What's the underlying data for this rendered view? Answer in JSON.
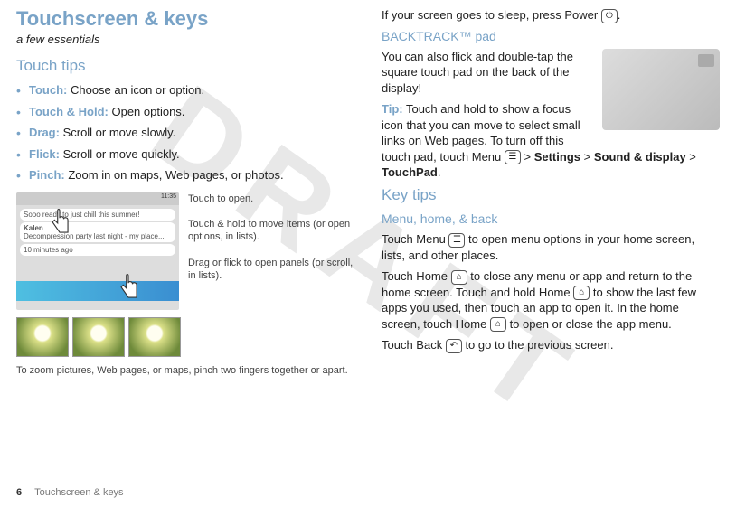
{
  "watermark": "DRAFT",
  "left": {
    "title": "Touchscreen & keys",
    "subtitle": "a few essentials",
    "section_touch_tips": "Touch tips",
    "tips": [
      {
        "term": "Touch:",
        "desc": " Choose an icon or option."
      },
      {
        "term": "Touch & Hold:",
        "desc": " Open options."
      },
      {
        "term": "Drag:",
        "desc": " Scroll or move slowly."
      },
      {
        "term": "Flick:",
        "desc": " Scroll or move quickly."
      },
      {
        "term": "Pinch:",
        "desc": " Zoom in on maps, Web pages, or photos."
      }
    ],
    "figure": {
      "status_time": "11:35",
      "line1": "Sooo ready to just chill this summer!",
      "line2_name": "Kalen",
      "line2_body": "Decompression party last night - my place...",
      "line3": "10 minutes ago",
      "annot1": "Touch to open.",
      "annot2": "Touch & hold to move items (or open options, in lists).",
      "annot3": "Drag or flick to open panels (or scroll, in lists)."
    },
    "zoom_caption": "To zoom pictures, Web pages, or maps, pinch two fingers together or apart."
  },
  "right": {
    "sleep_line_a": "If your screen goes to sleep, press Power ",
    "sleep_line_b": ".",
    "power_icon": "⏻",
    "section_backtrack": "BACKTRACK™ pad",
    "backtrack_p1": "You can also flick and double-tap the square touch pad on the back of the display!",
    "tip_label": "Tip:",
    "tip_body_a": " Touch and hold to show a focus icon that you can move to select small links on Web pages. To turn off this touch pad, touch Menu ",
    "tip_body_b": " > ",
    "settings": "Settings",
    "tip_body_c": " > ",
    "sound_display": "Sound & display",
    "tip_body_d": " > ",
    "touchpad": "TouchPad",
    "tip_body_e": ".",
    "section_key_tips": "Key tips",
    "section_mhb": "Menu, home, & back",
    "menu_icon": "☰",
    "home_icon": "⌂",
    "back_icon": "↶",
    "p_menu_a": "Touch Menu ",
    "p_menu_b": " to open menu options in your home screen, lists, and other places.",
    "p_home_a": "Touch Home ",
    "p_home_b": " to close any menu or app and return to the home screen. Touch and hold Home ",
    "p_home_c": " to show the last few apps you used, then touch an app to open it. In the home screen, touch Home ",
    "p_home_d": " to open or close the app menu.",
    "p_back_a": "Touch Back ",
    "p_back_b": " to go to the previous screen."
  },
  "footer": {
    "page_num": "6",
    "section": "Touchscreen & keys"
  }
}
